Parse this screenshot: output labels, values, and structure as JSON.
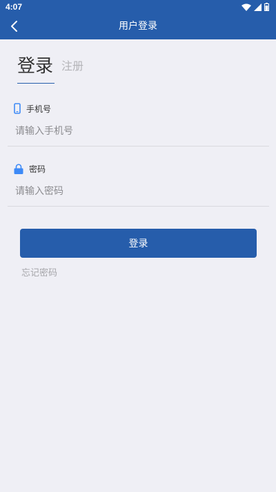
{
  "status_bar": {
    "time": "4:07",
    "icons": [
      "wifi-icon",
      "signal-icon",
      "battery-icon"
    ]
  },
  "app_bar": {
    "title": "用户登录",
    "back_icon": "chevron-left-icon"
  },
  "tabs": {
    "login_label": "登录",
    "register_label": "注册",
    "active": "login"
  },
  "form": {
    "phone": {
      "label": "手机号",
      "placeholder": "请输入手机号",
      "value": "",
      "icon": "phone-icon"
    },
    "password": {
      "label": "密码",
      "placeholder": "请输入密码",
      "value": "",
      "icon": "lock-icon"
    },
    "submit_label": "登录",
    "forgot_label": "忘记密码"
  },
  "colors": {
    "primary": "#265dab",
    "background": "#efeff5",
    "icon_accent": "#3d8af7"
  }
}
